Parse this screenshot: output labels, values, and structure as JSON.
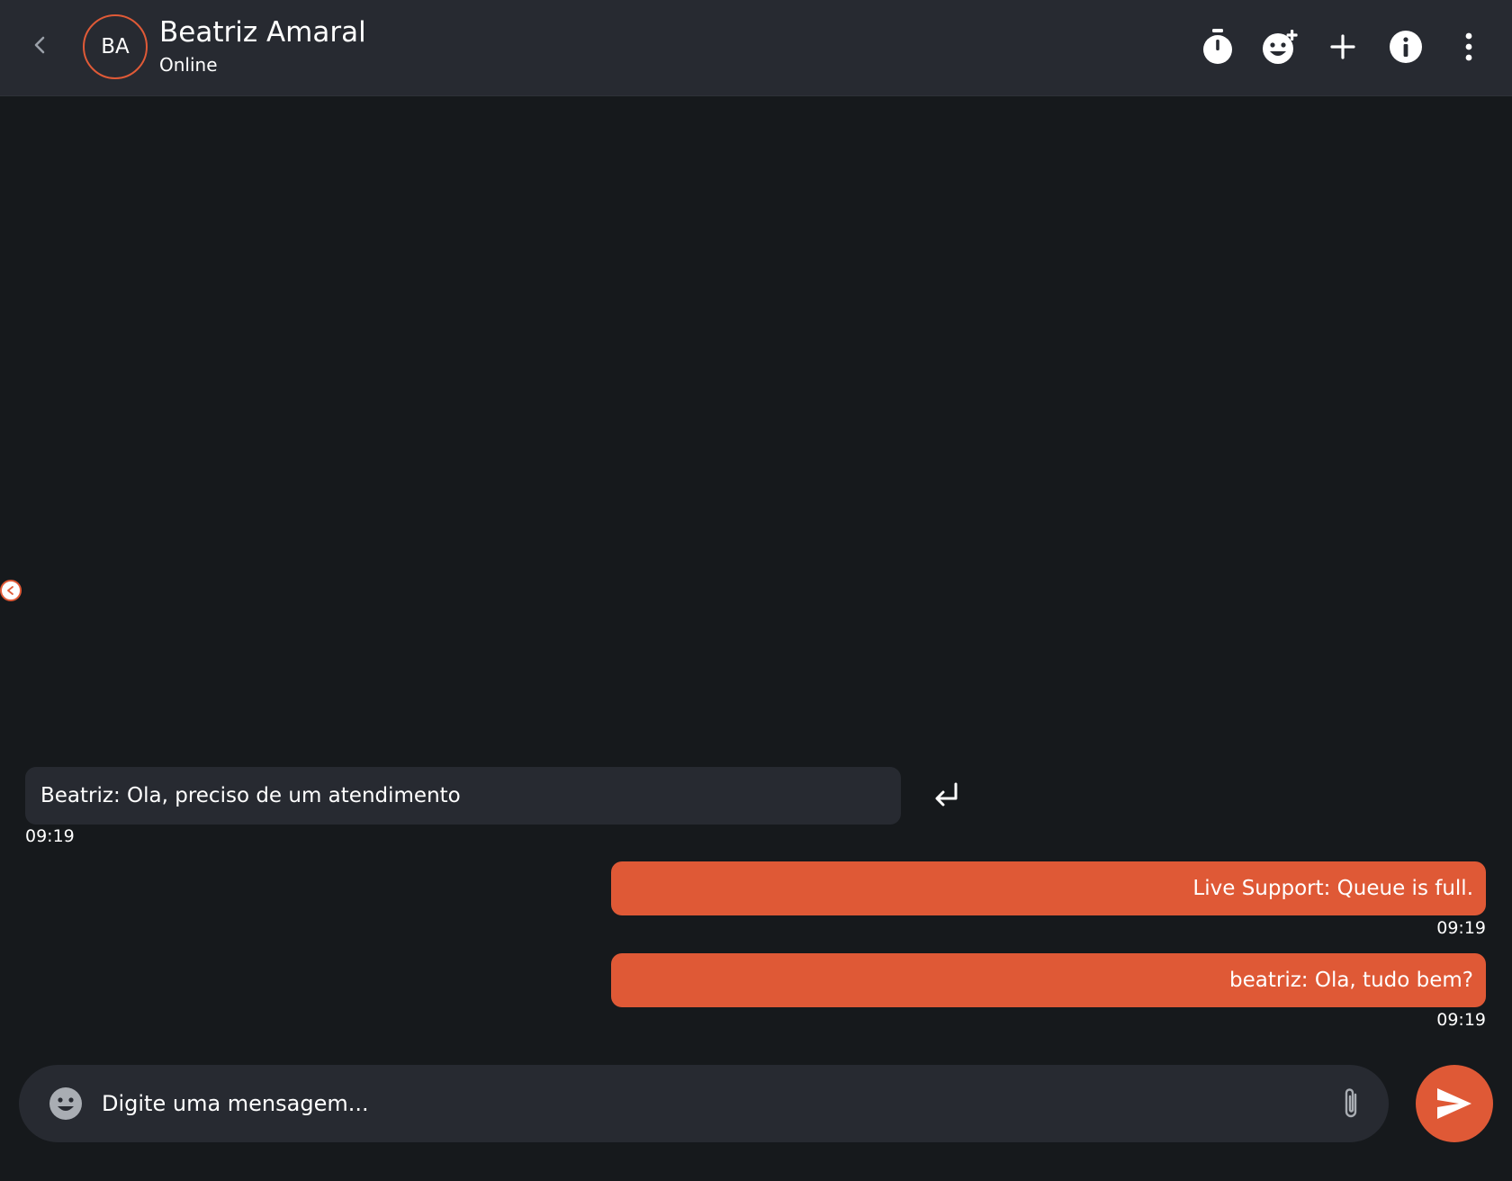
{
  "header": {
    "avatar_initials": "BA",
    "contact_name": "Beatriz Amaral",
    "status": "Online",
    "icons": [
      "chevron-left-icon",
      "timer-icon",
      "emoji-add-icon",
      "plus-icon",
      "info-icon",
      "more-vertical-icon"
    ]
  },
  "messages": [
    {
      "direction": "incoming",
      "text": "Beatriz: Ola, preciso de um atendimento",
      "time": "09:19"
    },
    {
      "direction": "outgoing",
      "text": "Live Support: Queue is full.",
      "time": "09:19"
    },
    {
      "direction": "outgoing",
      "text": "beatriz: Ola, tudo bem?",
      "time": "09:19"
    }
  ],
  "composer": {
    "placeholder": "Digite uma mensagem...",
    "value": ""
  },
  "colors": {
    "accent": "#df5936",
    "header_bg": "#272a31",
    "chat_bg": "#16191c",
    "incoming_bubble": "#272a31"
  }
}
